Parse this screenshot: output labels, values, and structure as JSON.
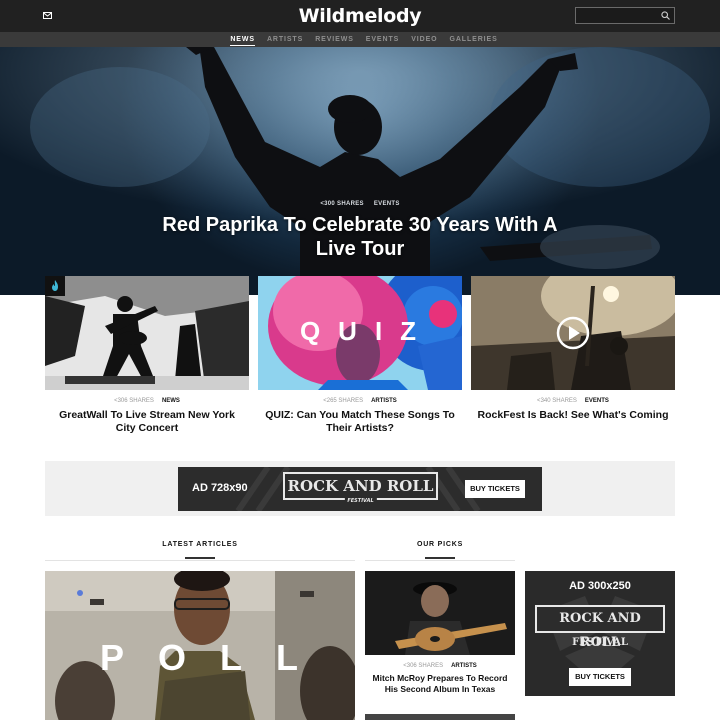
{
  "header": {
    "logo": "Wildmelody",
    "mail_icon": "mail-icon",
    "search": {
      "value": "",
      "icon": "search-icon"
    }
  },
  "nav": {
    "items": [
      "NEWS",
      "ARTISTS",
      "REVIEWS",
      "EVENTS",
      "VIDEO",
      "GALLERIES"
    ],
    "active": "NEWS"
  },
  "hero": {
    "shares": "300 SHARES",
    "category": "EVENTS",
    "title": "Red Paprika To Celebrate 30 Years With A Live Tour"
  },
  "cards": [
    {
      "shares": "306 SHARES",
      "category": "NEWS",
      "title": "GreatWall To Live Stream New York City Concert",
      "badge_icon": "flame-icon"
    },
    {
      "shares": "265 SHARES",
      "category": "ARTISTS",
      "title": "QUIZ: Can You Match These Songs To Their Artists?",
      "overlay": "QUIZ"
    },
    {
      "shares": "340 SHARES",
      "category": "EVENTS",
      "title": "RockFest Is Back! See What's Coming",
      "overlay_icon": "play-icon"
    }
  ],
  "ad_banner": {
    "label": "AD 728x90",
    "brand": "ROCK AND ROLL",
    "sub": "FESTIVAL",
    "button": "BUY TICKETS"
  },
  "sections": {
    "latest": "LATEST ARTICLES",
    "picks": "OUR PICKS"
  },
  "latest": {
    "overlay": "POLL"
  },
  "pick": {
    "shares": "306 SHARES",
    "category": "ARTISTS",
    "title": "Mitch McRoy Prepares To Record His Second Album In Texas"
  },
  "ad_side": {
    "label": "AD 300x250",
    "brand_top": "ROCK AND ROLL",
    "sub": "FESTIVAL",
    "button": "BUY TICKETS"
  },
  "colors": {
    "header_bg": "#212121",
    "nav_bg": "#3a3a3a",
    "hero_blue": "#2e4f6b",
    "quiz_pink": "#e8327a",
    "quiz_blue": "#2d6ed8"
  }
}
